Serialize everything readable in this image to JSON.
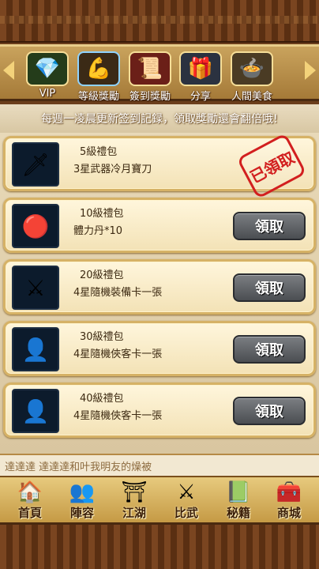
{
  "tabs": [
    {
      "label": "VIP",
      "icon": "gem-icon",
      "glyph": "💎",
      "bg": "#243c1a"
    },
    {
      "label": "等級獎勵",
      "icon": "muscle-arm-icon",
      "glyph": "💪",
      "bg": "#3b2a16"
    },
    {
      "label": "簽到獎勵",
      "icon": "scroll-icon",
      "glyph": "📜",
      "bg": "#6b1f18"
    },
    {
      "label": "分享",
      "icon": "treasure-gift-icon",
      "glyph": "🎁",
      "bg": "#2b3240"
    },
    {
      "label": "人間美食",
      "icon": "food-bowl-icon",
      "glyph": "🍲",
      "bg": "#4a3b24"
    }
  ],
  "notice": "每週一凌晨更新签到記録，領取獎勵還會翻倍哦!",
  "rewards": [
    {
      "title": "5級禮包",
      "desc": "3星武器冷月寶刀",
      "icon": "saber-icon",
      "glyph": "🗡",
      "claimed": true
    },
    {
      "title": "10級禮包",
      "desc": "體力丹*10",
      "icon": "red-pill-icon",
      "glyph": "🔴",
      "claimed": false
    },
    {
      "title": "20級禮包",
      "desc": "4星隨機裝備卡一張",
      "icon": "sword-icon",
      "glyph": "⚔",
      "claimed": false
    },
    {
      "title": "30級禮包",
      "desc": "4星隨機俠客卡一張",
      "icon": "hero-silhouette-icon",
      "glyph": "👤",
      "claimed": false
    },
    {
      "title": "40級禮包",
      "desc": "4星隨機俠客卡一張",
      "icon": "hero-silhouette-icon",
      "glyph": "👤",
      "claimed": false
    }
  ],
  "claim_label": "領取",
  "claimed_label": "已領取",
  "marquee": "達達達 達達達和叶我明友的燥被",
  "nav": [
    {
      "label": "首頁",
      "icon": "home-icon",
      "glyph": "🏠"
    },
    {
      "label": "陣容",
      "icon": "team-icon",
      "glyph": "👥"
    },
    {
      "label": "江湖",
      "icon": "jianghu-icon",
      "glyph": "⛩"
    },
    {
      "label": "比武",
      "icon": "duel-icon",
      "glyph": "⚔"
    },
    {
      "label": "秘籍",
      "icon": "book-icon",
      "glyph": "📗"
    },
    {
      "label": "商城",
      "icon": "chest-icon",
      "glyph": "🧰"
    }
  ]
}
